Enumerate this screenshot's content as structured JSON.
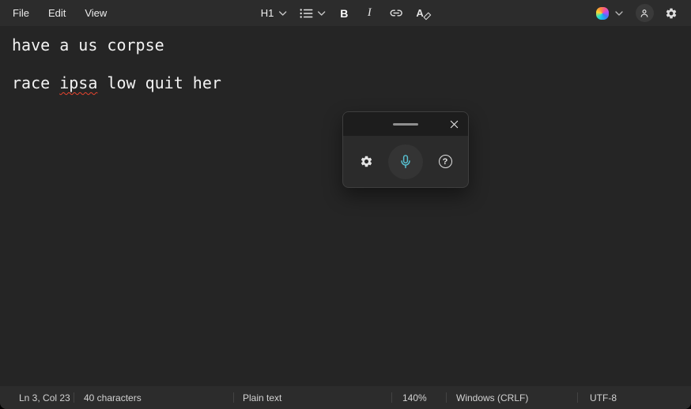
{
  "menubar": {
    "items": [
      {
        "label": "File"
      },
      {
        "label": "Edit"
      },
      {
        "label": "View"
      }
    ]
  },
  "toolbar": {
    "heading_label": "H1",
    "bold_label": "B",
    "italic_label": "I",
    "clear_format_label": "A"
  },
  "voice_typing": {
    "help_label": "?"
  },
  "editor": {
    "lines": [
      {
        "segments": [
          {
            "text": "have a us corpse",
            "misspelled": false
          }
        ]
      },
      {
        "segments": []
      },
      {
        "segments": [
          {
            "text": "race ",
            "misspelled": false
          },
          {
            "text": "ipsa",
            "misspelled": true
          },
          {
            "text": " low quit her",
            "misspelled": false
          }
        ]
      }
    ]
  },
  "statusbar": {
    "position": "Ln 3, Col 23",
    "character_count": "40 characters",
    "document_type": "Plain text",
    "zoom": "140%",
    "line_ending": "Windows (CRLF)",
    "encoding": "UTF-8"
  },
  "colors": {
    "mic_accent": "#58c3d4",
    "spellcheck_underline": "#e8442e",
    "titlebar_bg": "#2c2c2c",
    "editor_bg": "#252525",
    "dialog_body_bg": "#2b2b2b",
    "dialog_top_bg": "#1d1d1d"
  }
}
